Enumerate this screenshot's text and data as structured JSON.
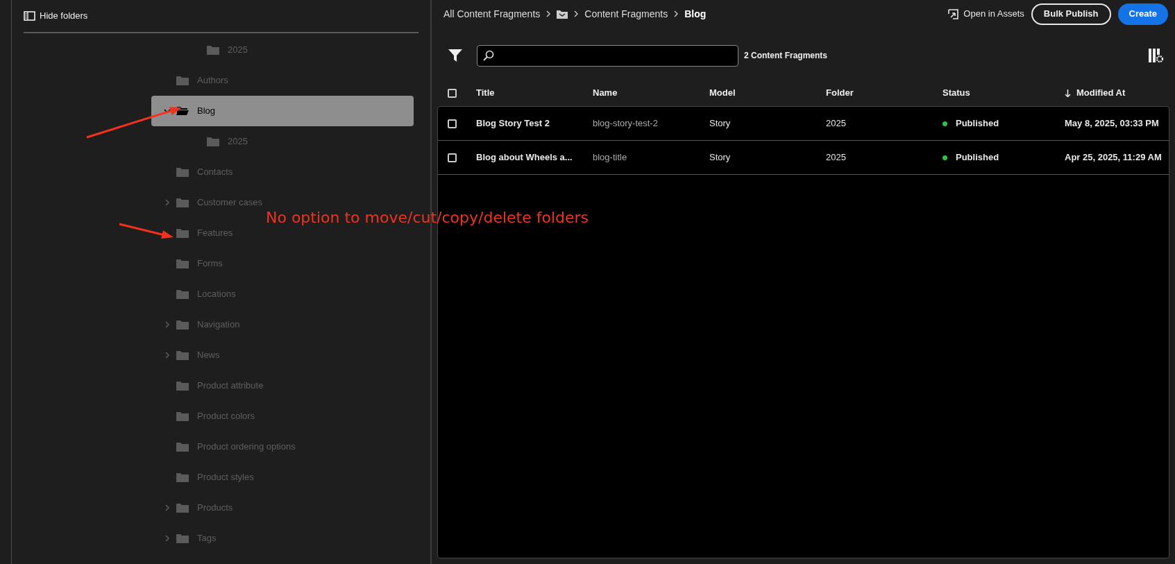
{
  "sidebar": {
    "toggle_label": "Hide folders",
    "tree": {
      "cut_children": [
        {
          "label": "2025"
        }
      ],
      "items": [
        {
          "label": "Authors",
          "selected": false,
          "expandable": false,
          "expanded": false
        },
        {
          "label": "Blog",
          "selected": true,
          "expandable": true,
          "expanded": true,
          "children": [
            {
              "label": "2025"
            }
          ]
        },
        {
          "label": "Contacts",
          "selected": false,
          "expandable": false,
          "expanded": false
        },
        {
          "label": "Customer cases",
          "selected": false,
          "expandable": true,
          "expanded": false
        },
        {
          "label": "Features",
          "selected": false,
          "expandable": false,
          "expanded": false
        },
        {
          "label": "Forms",
          "selected": false,
          "expandable": false,
          "expanded": false
        },
        {
          "label": "Locations",
          "selected": false,
          "expandable": false,
          "expanded": false
        },
        {
          "label": "Navigation",
          "selected": false,
          "expandable": true,
          "expanded": false
        },
        {
          "label": "News",
          "selected": false,
          "expandable": true,
          "expanded": false
        },
        {
          "label": "Product attribute",
          "selected": false,
          "expandable": false,
          "expanded": false
        },
        {
          "label": "Product colors",
          "selected": false,
          "expandable": false,
          "expanded": false
        },
        {
          "label": "Product ordering options",
          "selected": false,
          "expandable": false,
          "expanded": false
        },
        {
          "label": "Product styles",
          "selected": false,
          "expandable": false,
          "expanded": false
        },
        {
          "label": "Products",
          "selected": false,
          "expandable": true,
          "expanded": false
        },
        {
          "label": "Tags",
          "selected": false,
          "expandable": true,
          "expanded": false
        }
      ]
    }
  },
  "annotation": {
    "text": "No option to move/cut/copy/delete folders"
  },
  "breadcrumb": [
    {
      "label": "All Content Fragments",
      "kind": "text"
    },
    {
      "kind": "folder-icon"
    },
    {
      "label": "Content Fragments",
      "kind": "text"
    },
    {
      "label": "Blog",
      "kind": "current"
    }
  ],
  "actions": [
    {
      "label": "Open in Assets",
      "kind": "link"
    },
    {
      "label": "Bulk Publish",
      "kind": "outline"
    },
    {
      "label": "Create",
      "kind": "primary"
    }
  ],
  "search": {
    "count": "2 Content Fragments"
  },
  "table": {
    "select_all_checked": false,
    "columns": [
      {
        "label": "Title",
        "sorted": false
      },
      {
        "label": "Name",
        "sorted": false
      },
      {
        "label": "Model",
        "sorted": false
      },
      {
        "label": "Folder",
        "sorted": false
      },
      {
        "label": "Status",
        "sorted": false
      },
      {
        "label": "Modified At",
        "sorted": true
      }
    ],
    "rows": [
      {
        "title": "Blog Story Test 2",
        "name": "blog-story-test-2",
        "model": "Story",
        "folder": "2025",
        "status": "Published",
        "color": "#2ec44a",
        "modified": "May 8, 2025, 03:33 PM",
        "checked": false
      },
      {
        "title": "Blog about Wheels a...",
        "name": "blog-title",
        "model": "Story",
        "folder": "2025",
        "status": "Published",
        "color": "#2ec44a",
        "modified": "Apr 25, 2025, 11:29 AM",
        "checked": false
      }
    ]
  }
}
